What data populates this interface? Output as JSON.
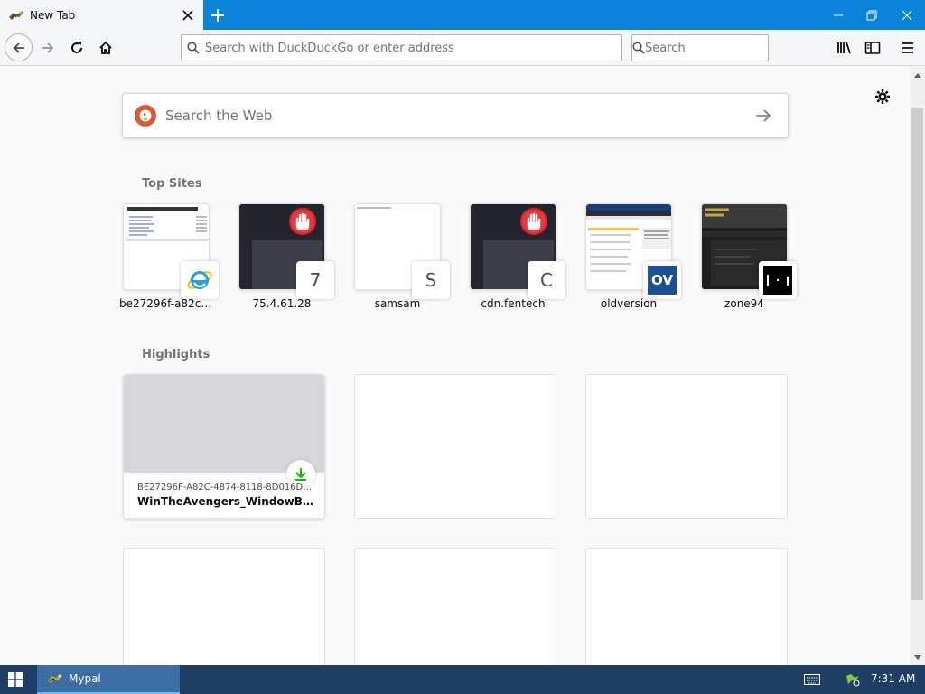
{
  "tab": {
    "title": "New Tab"
  },
  "navbar": {
    "url_placeholder": "Search with DuckDuckGo or enter address",
    "search_placeholder": "Search"
  },
  "newtab": {
    "web_search_placeholder": "Search the Web",
    "top_sites_title": "Top Sites",
    "highlights_title": "Highlights",
    "top_sites": [
      {
        "label": "be27296f-a82c-4...",
        "badge": ""
      },
      {
        "label": "75.4.61.28",
        "badge": "7"
      },
      {
        "label": "samsam",
        "badge": "S"
      },
      {
        "label": "cdn.fentech",
        "badge": "C"
      },
      {
        "label": "oldversion",
        "badge": "OV"
      },
      {
        "label": "zone94",
        "badge": ""
      }
    ],
    "highlights": [
      {
        "url": "BE27296F-A82C-4874-8118-8D016DD421D...",
        "title": "WinTheAvengers_WindowBlinds..."
      }
    ]
  },
  "taskbar": {
    "app_label": "Mypal",
    "clock": "7:31 AM"
  },
  "colors": {
    "accent": "#0a84d8",
    "taskbar": "#1f3e63",
    "download_green": "#12bc00"
  }
}
